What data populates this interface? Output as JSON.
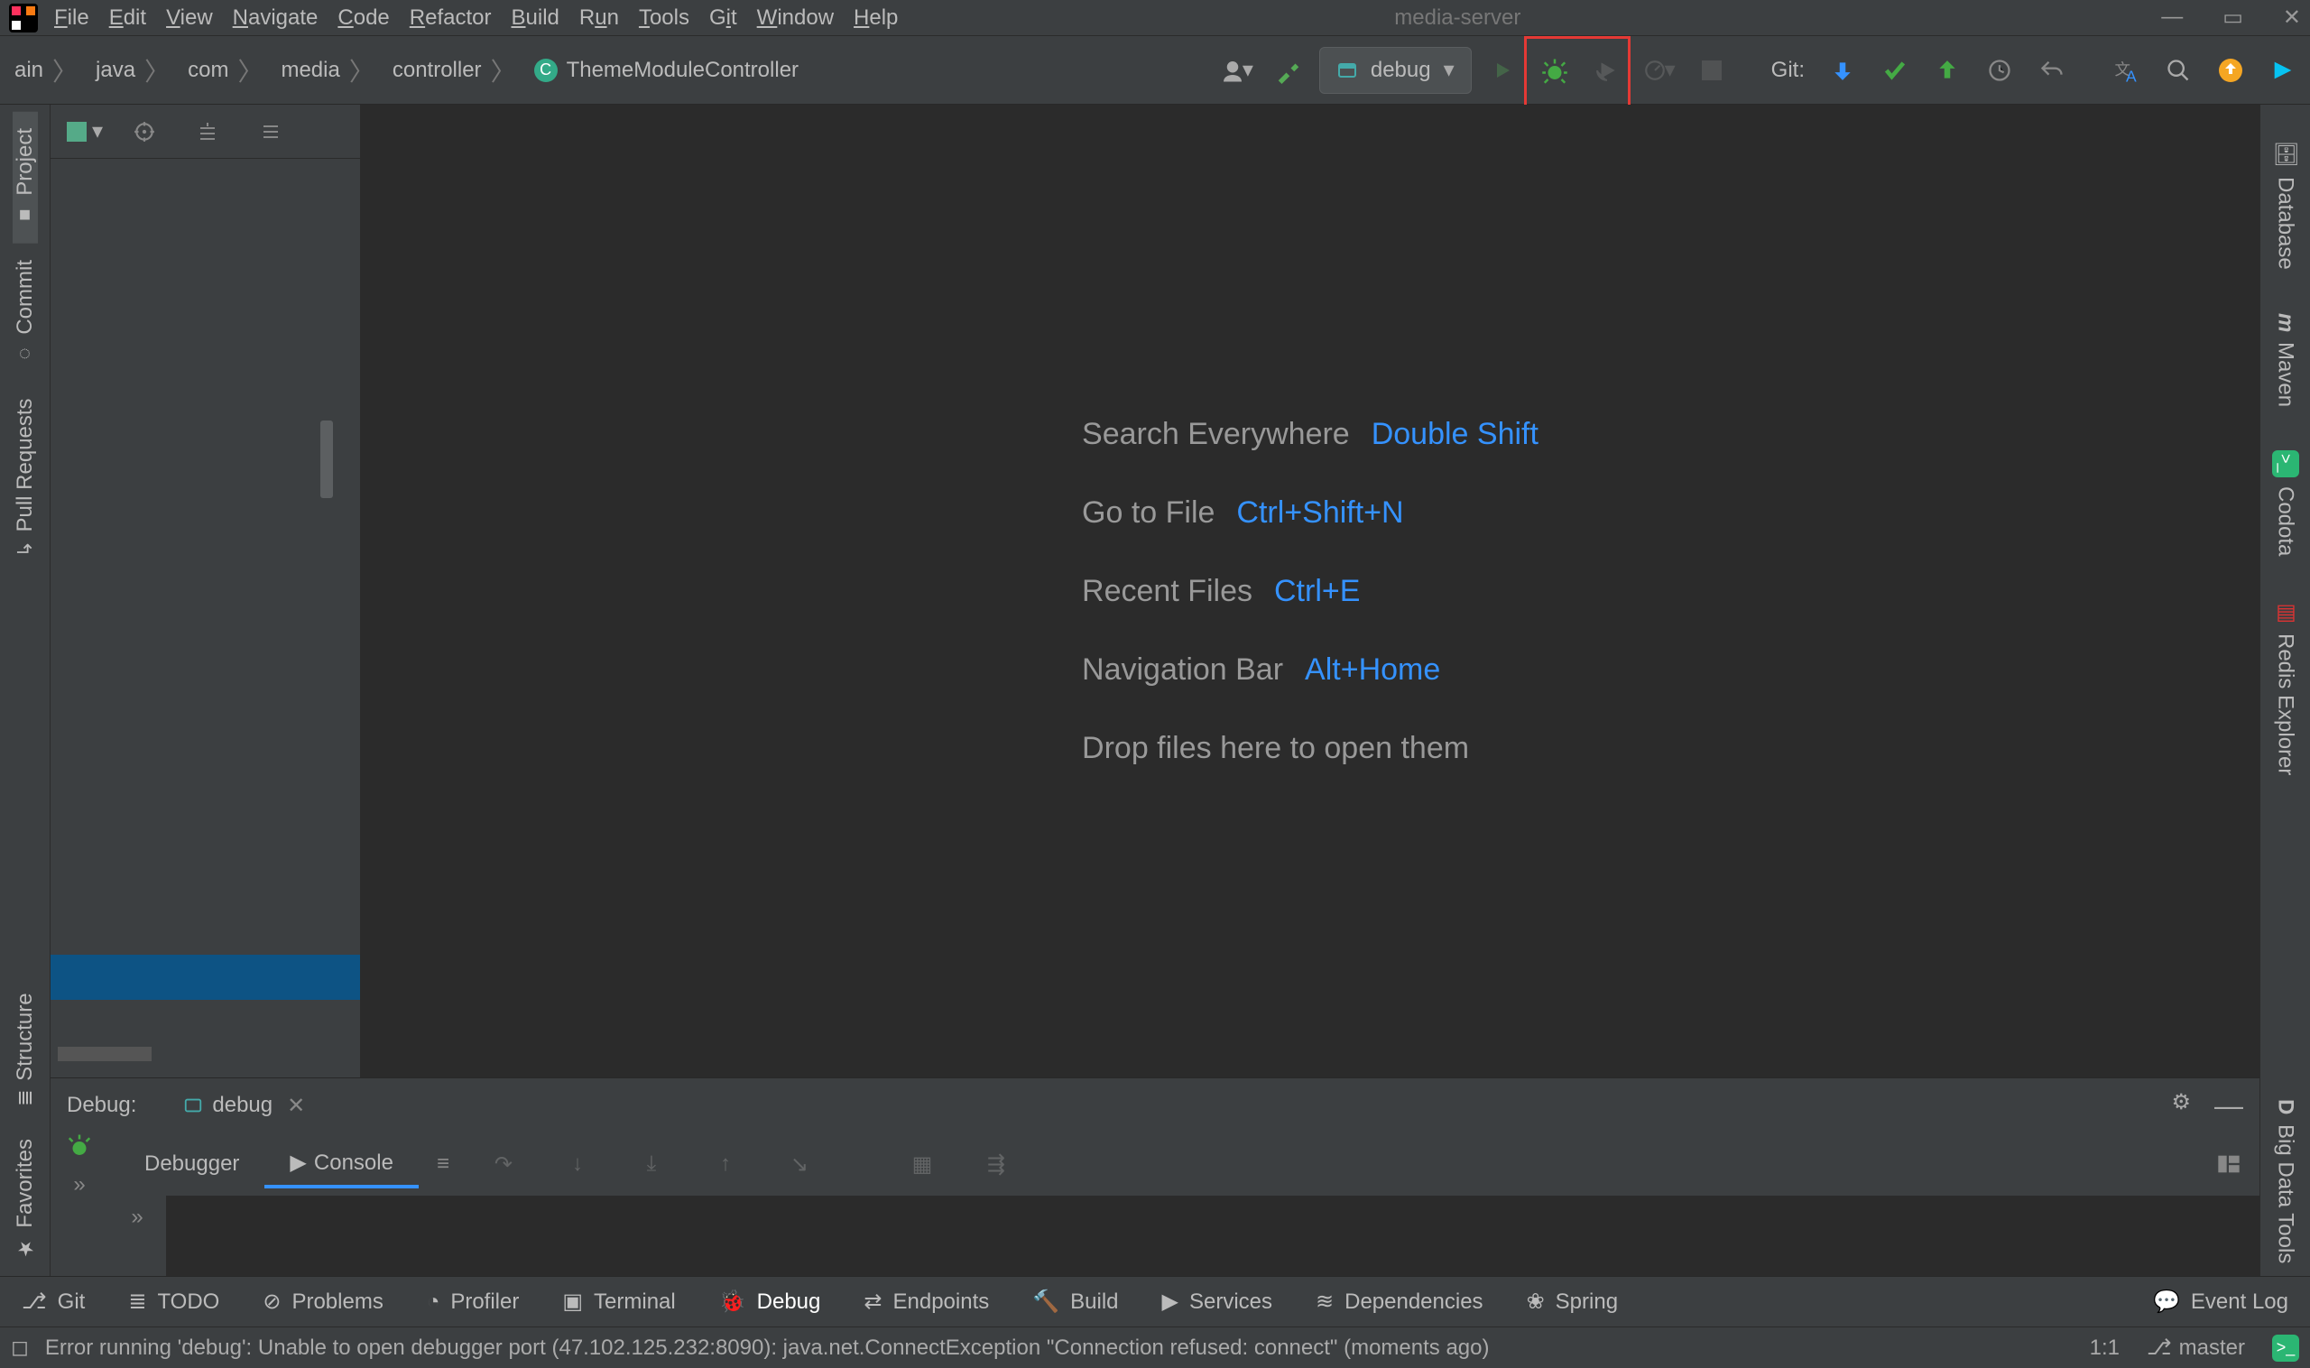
{
  "window": {
    "project_name": "media-server"
  },
  "menu": {
    "file": "File",
    "edit": "Edit",
    "view": "View",
    "navigate": "Navigate",
    "code": "Code",
    "refactor": "Refactor",
    "build": "Build",
    "run": "Run",
    "tools": "Tools",
    "git": "Git",
    "window": "Window",
    "help": "Help"
  },
  "breadcrumb": [
    "ain",
    "java",
    "com",
    "media",
    "controller",
    "ThemeModuleController"
  ],
  "run_config": {
    "label": "debug"
  },
  "toolbar": {
    "git_label": "Git:"
  },
  "left_tabs": {
    "project": "Project",
    "commit": "Commit",
    "pull_requests": "Pull Requests",
    "structure": "Structure",
    "favorites": "Favorites"
  },
  "right_tabs": {
    "database": "Database",
    "maven": "Maven",
    "codota": "Codota",
    "redis": "Redis Explorer",
    "bigdata": "Big Data Tools"
  },
  "editor_hints": {
    "search": {
      "label": "Search Everywhere",
      "key": "Double Shift"
    },
    "goto": {
      "label": "Go to File",
      "key": "Ctrl+Shift+N"
    },
    "recent": {
      "label": "Recent Files",
      "key": "Ctrl+E"
    },
    "navbar": {
      "label": "Navigation Bar",
      "key": "Alt+Home"
    },
    "drop": {
      "label": "Drop files here to open them"
    }
  },
  "debug": {
    "panel_title": "Debug:",
    "tab_name": "debug",
    "sub_tabs": {
      "debugger": "Debugger",
      "console": "Console"
    }
  },
  "bottom_tools": {
    "git": "Git",
    "todo": "TODO",
    "problems": "Problems",
    "profiler": "Profiler",
    "terminal": "Terminal",
    "debug": "Debug",
    "endpoints": "Endpoints",
    "build": "Build",
    "services": "Services",
    "dependencies": "Dependencies",
    "spring": "Spring",
    "event_log": "Event Log"
  },
  "status": {
    "message": "Error running 'debug': Unable to open debugger port (47.102.125.232:8090): java.net.ConnectException \"Connection refused: connect\" (moments ago)",
    "position": "1:1",
    "branch": "master"
  }
}
